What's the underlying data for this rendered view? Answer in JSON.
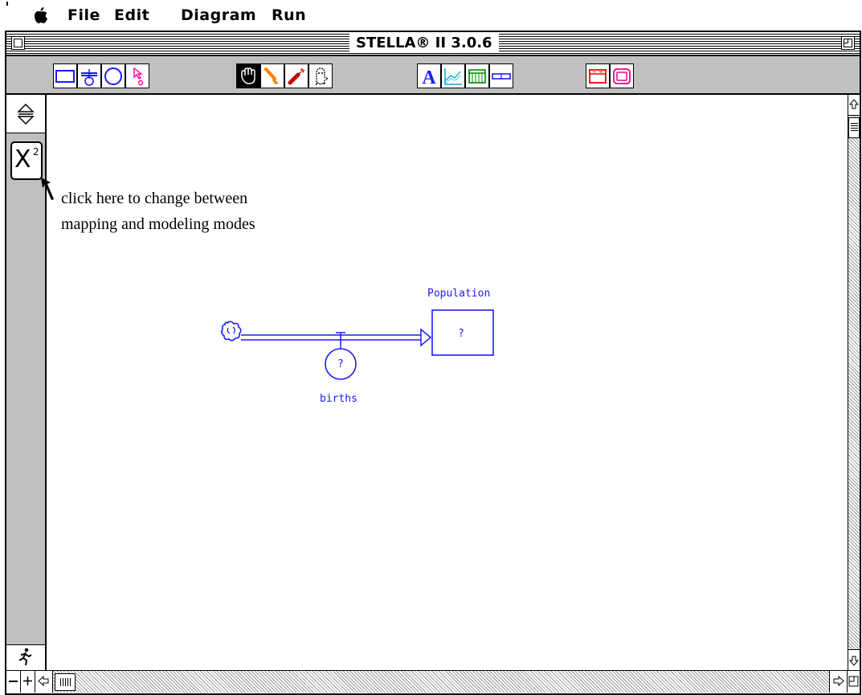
{
  "menu": {
    "apple_icon": "apple-icon",
    "items": [
      "File",
      "Edit",
      "Diagram",
      "Run"
    ]
  },
  "window": {
    "title": "STELLA® II 3.0.6"
  },
  "toolbar": {
    "tools": [
      {
        "name": "stock-tool",
        "icon": "rectangle-icon"
      },
      {
        "name": "flow-tool",
        "icon": "flow-icon"
      },
      {
        "name": "converter-tool",
        "icon": "circle-icon"
      },
      {
        "name": "connector-tool",
        "icon": "connector-icon"
      },
      {
        "name": "hand-tool",
        "icon": "hand-icon"
      },
      {
        "name": "paintbrush-tool",
        "icon": "paintbrush-icon"
      },
      {
        "name": "dynamite-tool",
        "icon": "dynamite-icon"
      },
      {
        "name": "ghost-tool",
        "icon": "ghost-icon"
      },
      {
        "name": "text-tool",
        "icon": "letter-a-icon"
      },
      {
        "name": "graph-tool",
        "icon": "graph-icon"
      },
      {
        "name": "table-tool",
        "icon": "table-icon"
      },
      {
        "name": "numeric-display-tool",
        "icon": "numeric-display-icon"
      },
      {
        "name": "sector-frame-tool",
        "icon": "sector-icon"
      },
      {
        "name": "button-tool",
        "icon": "button-icon"
      }
    ]
  },
  "left_strip": {
    "mode_toggle": "X",
    "mode_toggle_sup": "2"
  },
  "annotation": {
    "line1": "click here to change between",
    "line2": "mapping and modeling modes"
  },
  "diagram": {
    "stock_label": "Population",
    "stock_value": "?",
    "flow_label": "births",
    "flow_value": "?"
  },
  "colors": {
    "diagram_blue": "#1a1aff",
    "toolbar_gray": "#c0c0c0"
  }
}
